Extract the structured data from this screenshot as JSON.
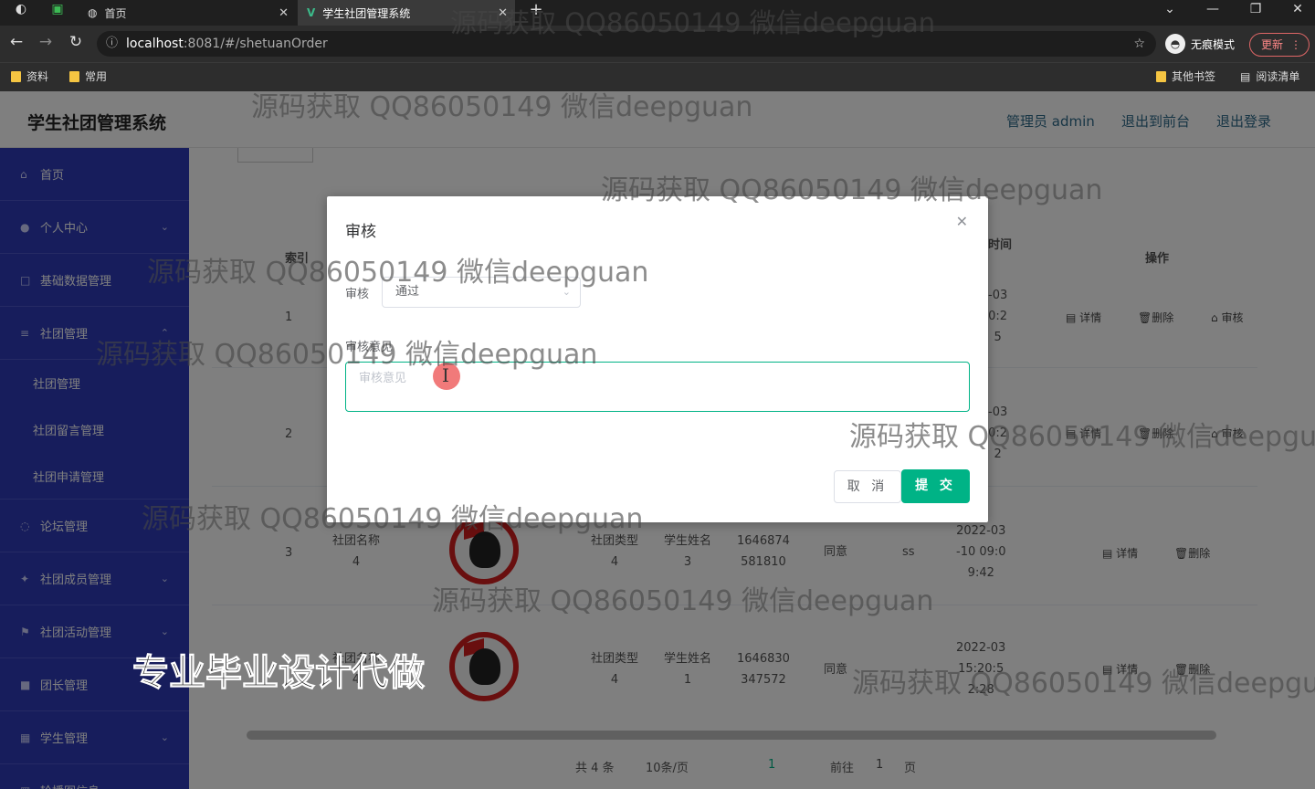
{
  "browser": {
    "tabs": [
      {
        "label": "首页"
      },
      {
        "label": "学生社团管理系统"
      }
    ],
    "url_host": "localhost",
    "url_path": ":8081/#/shetuanOrder",
    "incognito_label": "无痕模式",
    "update_label": "更新",
    "bookmarks": [
      "资料",
      "常用"
    ],
    "other_bookmarks": "其他书签",
    "reading_list": "阅读清单"
  },
  "app": {
    "title": "学生社团管理系统",
    "admin": "管理员 admin",
    "to_front": "退出到前台",
    "logout": "退出登录"
  },
  "sidebar": {
    "items": [
      {
        "label": "首页",
        "icon": "home-icon"
      },
      {
        "label": "个人中心",
        "icon": "user-icon",
        "arrow": "⌄"
      },
      {
        "label": "基础数据管理",
        "icon": "grid-icon"
      },
      {
        "label": "社团管理",
        "icon": "list-icon",
        "arrow": "⌃"
      }
    ],
    "sub": [
      "社团管理",
      "社团留言管理",
      "社团申请管理"
    ],
    "more": [
      {
        "label": "论坛管理",
        "icon": "chat-icon"
      },
      {
        "label": "社团成员管理",
        "icon": "team-icon",
        "arrow": "⌄"
      },
      {
        "label": "社团活动管理",
        "icon": "flag-icon",
        "arrow": "⌄"
      },
      {
        "label": "团长管理",
        "icon": "badge-icon"
      },
      {
        "label": "学生管理",
        "icon": "student-icon",
        "arrow": "⌄"
      },
      {
        "label": "轮播图信息",
        "icon": "image-icon",
        "arrow": "⌄"
      }
    ]
  },
  "table": {
    "headers": {
      "index": "索引",
      "time": "时间",
      "ops": "操作"
    },
    "rows": [
      {
        "index": "1",
        "time": "-03\n0:2\n5"
      },
      {
        "index": "2",
        "time": "-03\n0:2\n2"
      },
      {
        "index": "3",
        "club": "社团名称\n4",
        "type": "社团类型\n4",
        "student": "学生姓名\n3",
        "phone": "1646874\n581810",
        "status": "同意",
        "remark": "ss",
        "time": "2022-03\n-10 09:0\n9:42"
      },
      {
        "index": "4",
        "club": "社团名称\n4",
        "type": "社团类型\n4",
        "student": "学生姓名\n1",
        "phone": "1646830\n347572",
        "status": "同意",
        "time": "2022-03\n15:20:5\n2:28"
      }
    ],
    "ops": {
      "detail": "详情",
      "delete": "删除",
      "audit": "审核"
    }
  },
  "pagination": {
    "total": "共 4 条",
    "size": "10条/页",
    "current": "1",
    "goto": "前往",
    "page_input": "1",
    "page_unit": "页"
  },
  "modal": {
    "title": "审核",
    "audit_label": "审核",
    "audit_value": "通过",
    "opinion_label": "审核意见",
    "opinion_placeholder": "审核意见",
    "cancel": "取 消",
    "submit": "提 交"
  },
  "watermarks": {
    "qq": "源码获取 QQ86050149 微信deepguan",
    "banner": "专业毕业设计代做"
  }
}
